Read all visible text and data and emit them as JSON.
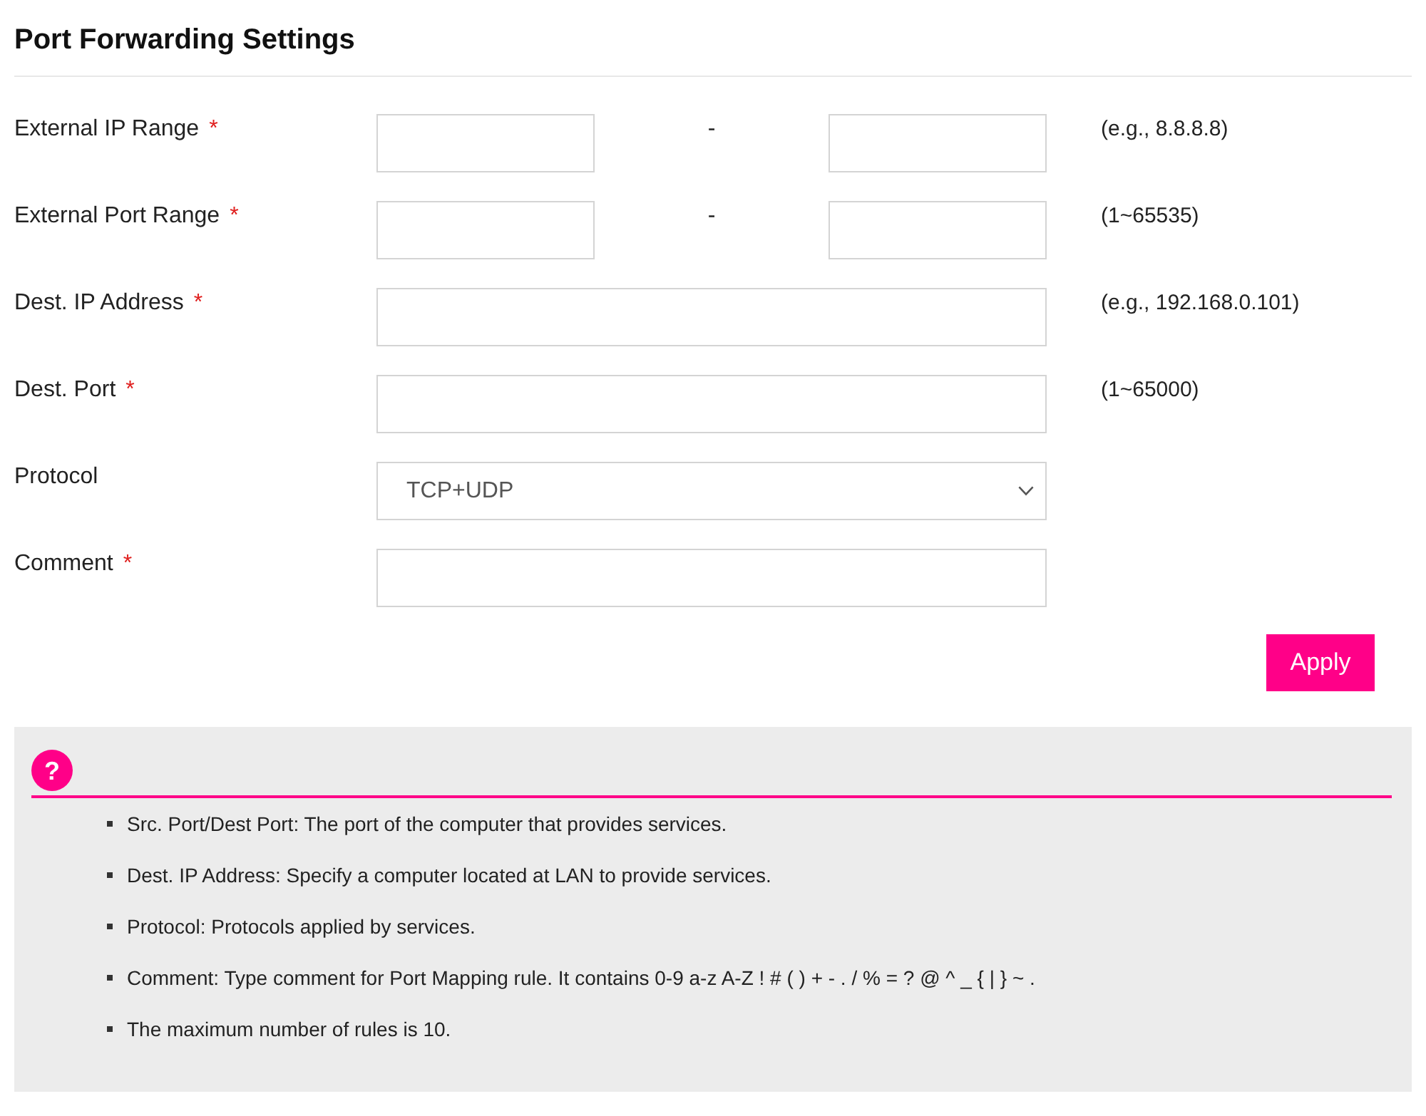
{
  "title": "Port Forwarding Settings",
  "fields": [
    {
      "kind": "range",
      "label": "External IP Range",
      "required_mark": "*",
      "separator": "-",
      "hint": "(e.g., 8.8.8.8)"
    },
    {
      "kind": "range",
      "label": "External Port Range",
      "required_mark": "*",
      "separator": "-",
      "hint": "(1~65535)"
    },
    {
      "kind": "text",
      "label": "Dest. IP Address",
      "required_mark": "*",
      "hint": "(e.g., 192.168.0.101)"
    },
    {
      "kind": "text",
      "label": "Dest. Port",
      "required_mark": "*",
      "hint": "(1~65000)"
    },
    {
      "kind": "select",
      "label": "Protocol",
      "value": "TCP+UDP"
    },
    {
      "kind": "text",
      "label": "Comment",
      "required_mark": "*"
    }
  ],
  "apply_button": {
    "label": "Apply"
  },
  "help": {
    "icon": "?",
    "items": [
      "Src. Port/Dest Port: The port of the computer that provides services.",
      "Dest. IP Address: Specify a computer located at LAN to provide services.",
      "Protocol: Protocols applied by services.",
      "Comment: Type comment for Port Mapping rule. It contains 0-9 a-z A-Z ! # ( ) + - . / % = ? @ ^ _ { | } ~ .",
      "The maximum number of rules is 10."
    ]
  }
}
